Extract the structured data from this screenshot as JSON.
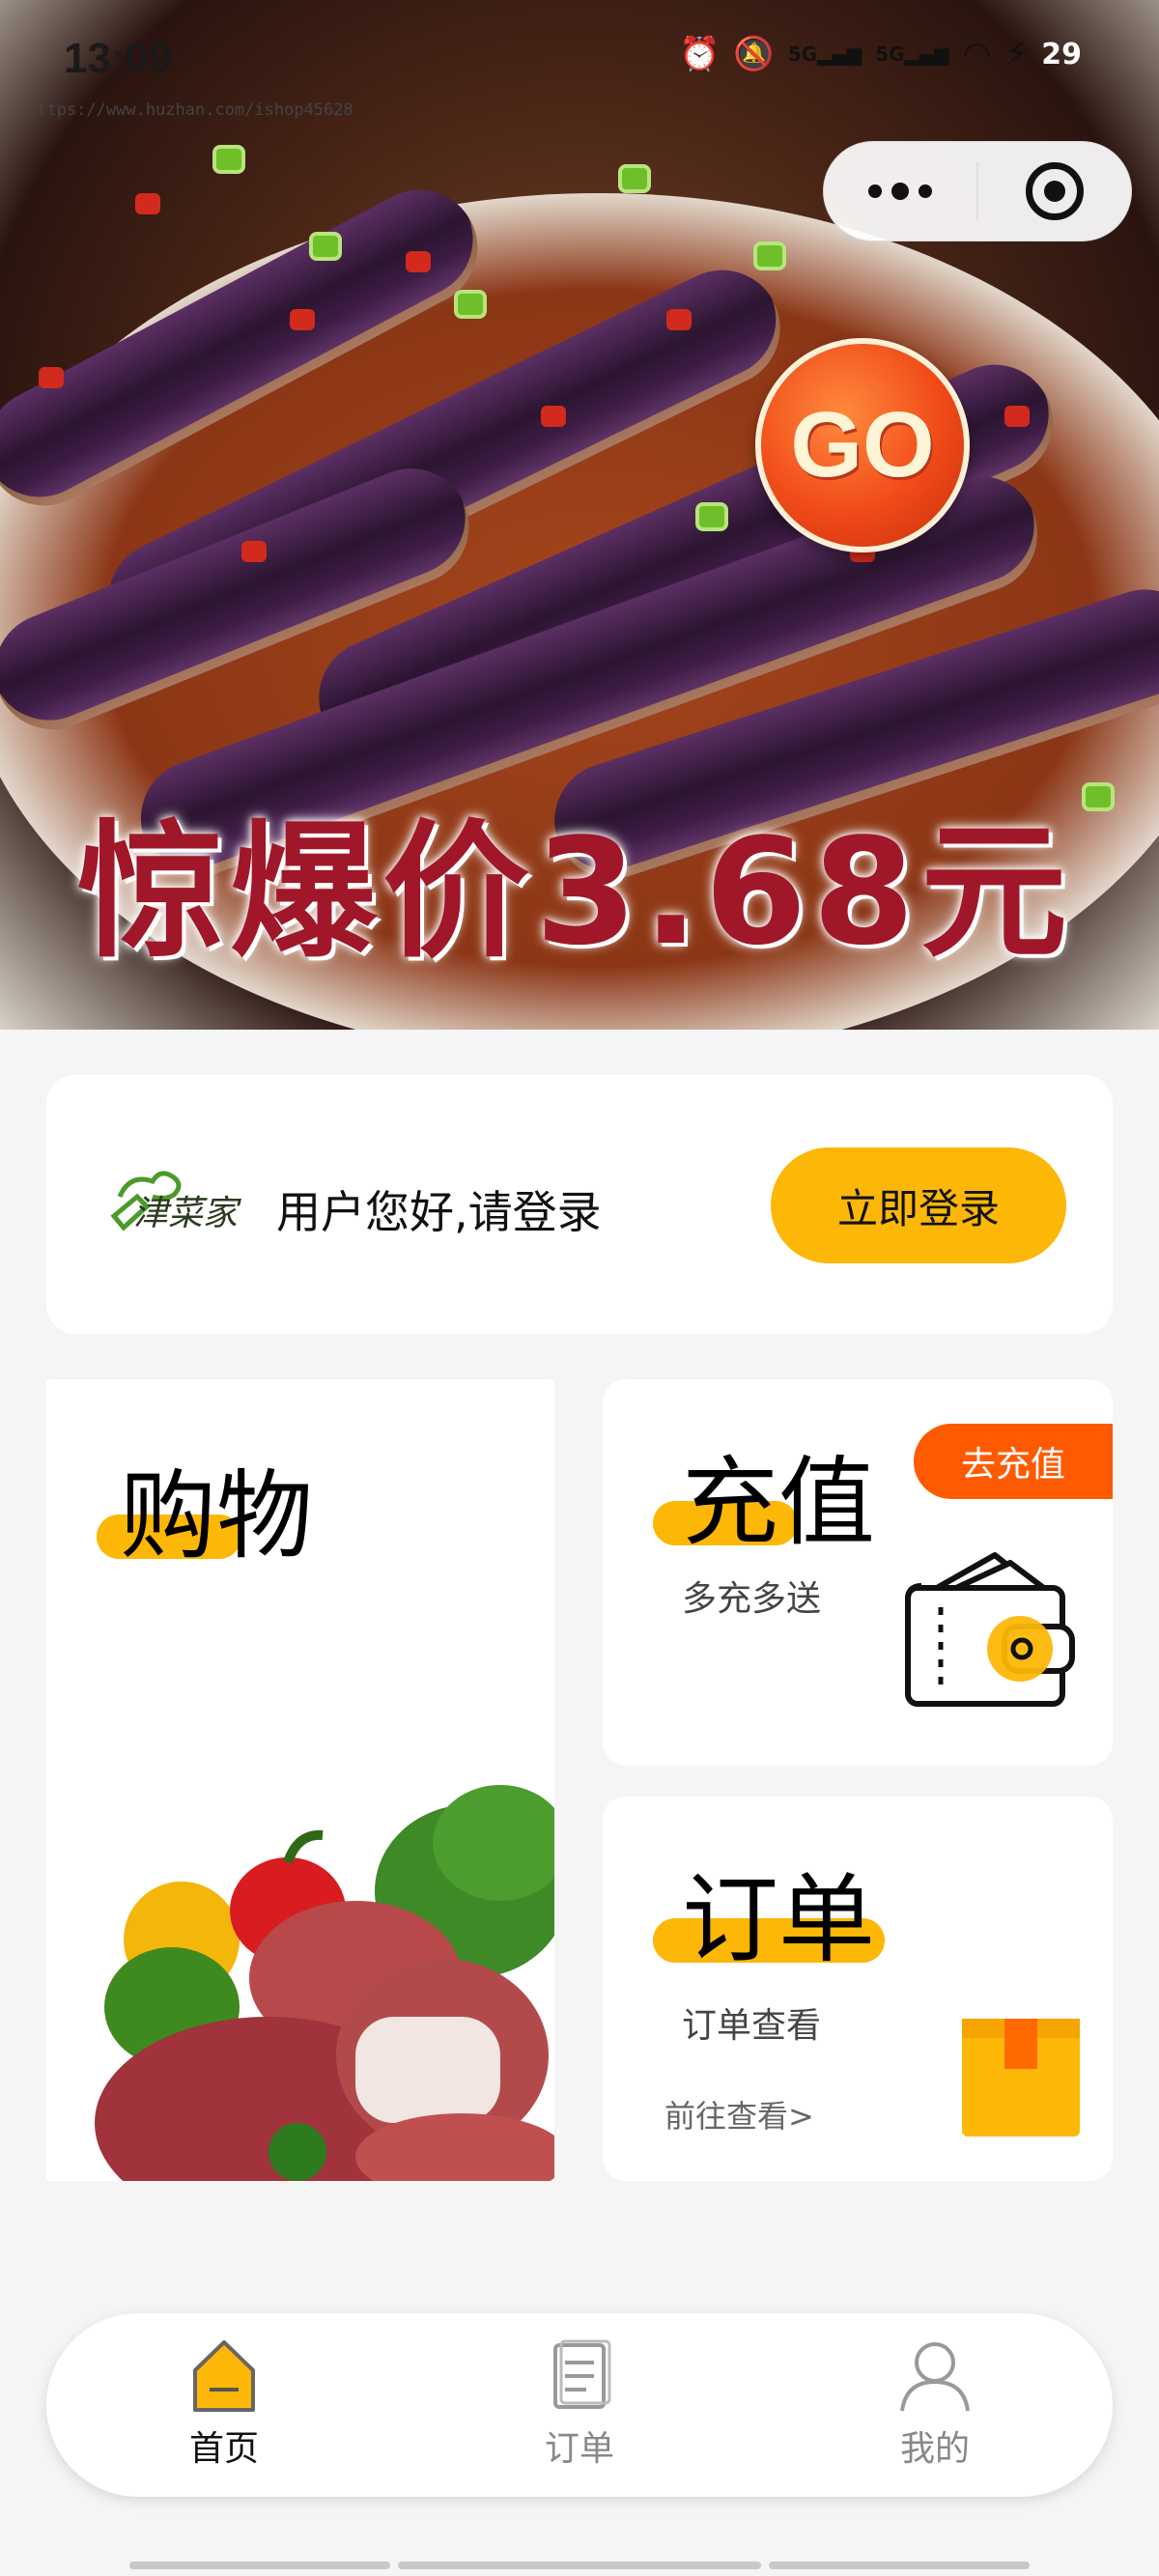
{
  "status_bar": {
    "time": "13:09",
    "network_1": "5G",
    "network_2": "5G",
    "battery": "29"
  },
  "watermark_url": "https://www.huzhan.com/ishop45628",
  "banner": {
    "promo_text": "惊爆价3.68元",
    "go_badge": "GO"
  },
  "login": {
    "logo_text": "津菜家",
    "greeting": "用户您好,请登录",
    "button": "立即登录"
  },
  "tiles": {
    "shop": {
      "title": "购物"
    },
    "recharge": {
      "title": "充值",
      "subtitle": "多充多送",
      "tag": "去充值"
    },
    "orders": {
      "title": "订单",
      "subtitle": "订单查看",
      "link": "前往查看>"
    }
  },
  "nav": [
    {
      "label": "首页",
      "icon": "home-icon",
      "active": true
    },
    {
      "label": "订单",
      "icon": "order-list-icon",
      "active": false
    },
    {
      "label": "我的",
      "icon": "user-icon",
      "active": false
    }
  ],
  "colors": {
    "accent": "#fdb706",
    "tag_orange": "#ff5a00",
    "promo_red": "#a0172a"
  }
}
